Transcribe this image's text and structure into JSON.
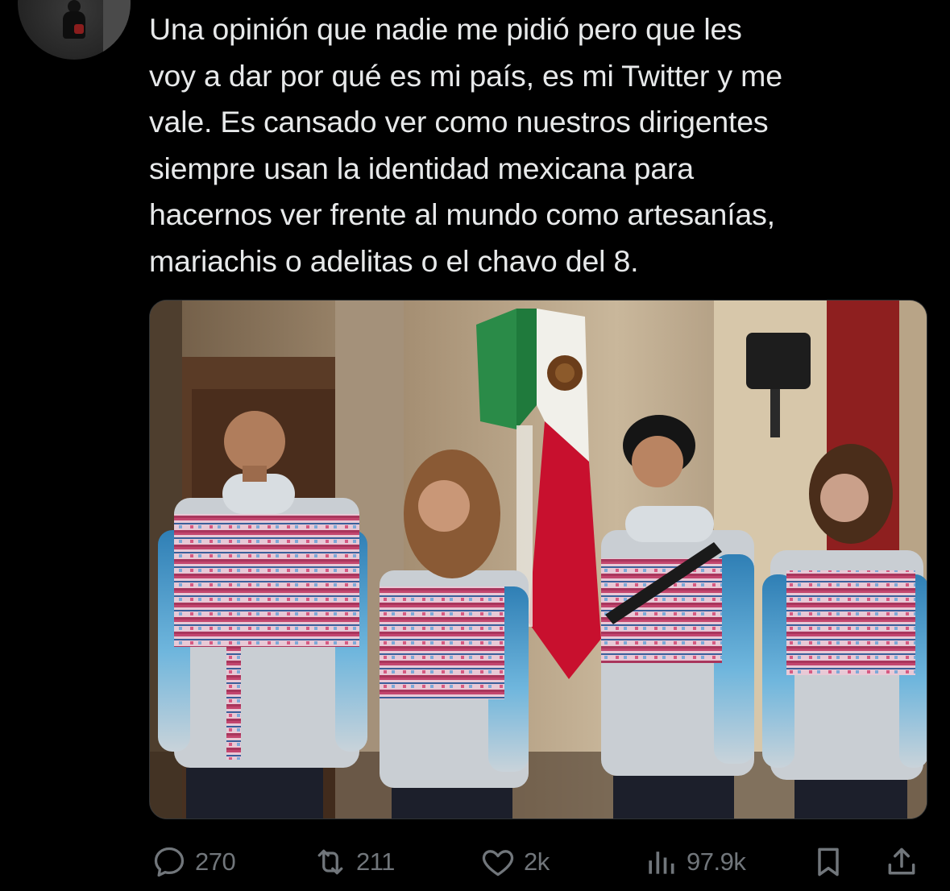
{
  "tweet": {
    "text": "Una opinión que nadie me pidió pero que les\nvoy a dar por qué es mi país, es mi Twitter y me\nvale. Es cansado ver como nuestros dirigentes\nsiempre usan la identidad mexicana para\nhacernos ver frente al mundo como artesanías,\nmariachis o adelitas o el chavo del 8."
  },
  "media": {
    "icon": "photo",
    "subject_colors": {
      "flag_green": "#1f7a3c",
      "flag_white": "#f1f0ea",
      "flag_red": "#c8102e",
      "jacket_grey": "#c9ced3",
      "jacket_blue": "#3d8fc0",
      "pattern_pink": "#d65a82"
    }
  },
  "actions": {
    "reply": {
      "icon": "reply-icon",
      "count": "270"
    },
    "retweet": {
      "icon": "retweet-icon",
      "count": "211"
    },
    "like": {
      "icon": "heart-icon",
      "count": "2k"
    },
    "views": {
      "icon": "views-icon",
      "count": "97.9k"
    },
    "bookmark": {
      "icon": "bookmark-icon"
    },
    "share": {
      "icon": "share-icon"
    }
  },
  "theme": {
    "background": "#000000",
    "text": "#e7e9ea",
    "muted": "#71767b"
  }
}
